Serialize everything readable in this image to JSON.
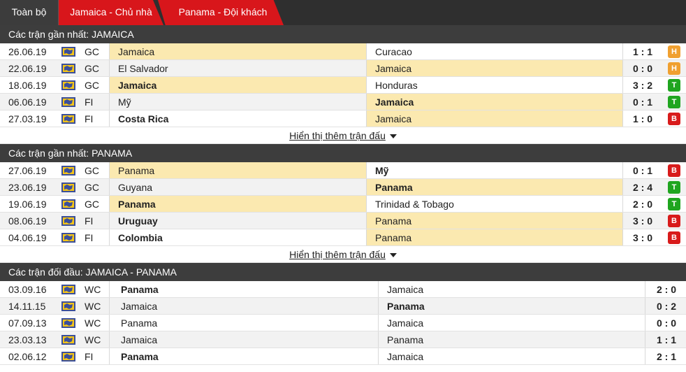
{
  "tabs": [
    "Toàn bộ",
    "Jamaica - Chủ nhà",
    "Panama - Đội khách"
  ],
  "show_more_label": "Hiển thị thêm trận đấu",
  "colors": {
    "hoa": "#f0a030",
    "thang": "#1fa51f",
    "bai": "#d81b1b",
    "highlight": "#fbe9b0"
  },
  "sections": [
    {
      "title": "Các trận gần nhất: JAMAICA",
      "rows": [
        {
          "date": "26.06.19",
          "comp": "GC",
          "home": "Jamaica",
          "away": "Curacao",
          "score": "1 : 1",
          "result": "H",
          "hl": "home",
          "bold": ""
        },
        {
          "date": "22.06.19",
          "comp": "GC",
          "home": "El Salvador",
          "away": "Jamaica",
          "score": "0 : 0",
          "result": "H",
          "hl": "away",
          "bold": ""
        },
        {
          "date": "18.06.19",
          "comp": "GC",
          "home": "Jamaica",
          "away": "Honduras",
          "score": "3 : 2",
          "result": "T",
          "hl": "home",
          "bold": "home"
        },
        {
          "date": "06.06.19",
          "comp": "FI",
          "home": "Mỹ",
          "away": "Jamaica",
          "score": "0 : 1",
          "result": "T",
          "hl": "away",
          "bold": "away"
        },
        {
          "date": "27.03.19",
          "comp": "FI",
          "home": "Costa Rica",
          "away": "Jamaica",
          "score": "1 : 0",
          "result": "B",
          "hl": "away",
          "bold": "home"
        }
      ]
    },
    {
      "title": "Các trận gần nhất: PANAMA",
      "rows": [
        {
          "date": "27.06.19",
          "comp": "GC",
          "home": "Panama",
          "away": "Mỹ",
          "score": "0 : 1",
          "result": "B",
          "hl": "home",
          "bold": "away"
        },
        {
          "date": "23.06.19",
          "comp": "GC",
          "home": "Guyana",
          "away": "Panama",
          "score": "2 : 4",
          "result": "T",
          "hl": "away",
          "bold": "away"
        },
        {
          "date": "19.06.19",
          "comp": "GC",
          "home": "Panama",
          "away": "Trinidad & Tobago",
          "score": "2 : 0",
          "result": "T",
          "hl": "home",
          "bold": "home"
        },
        {
          "date": "08.06.19",
          "comp": "FI",
          "home": "Uruguay",
          "away": "Panama",
          "score": "3 : 0",
          "result": "B",
          "hl": "away",
          "bold": "home"
        },
        {
          "date": "04.06.19",
          "comp": "FI",
          "home": "Colombia",
          "away": "Panama",
          "score": "3 : 0",
          "result": "B",
          "hl": "away",
          "bold": "home"
        }
      ]
    }
  ],
  "h2h": {
    "title": "Các trận đối đầu: JAMAICA - PANAMA",
    "rows": [
      {
        "date": "03.09.16",
        "comp": "WC",
        "home": "Panama",
        "away": "Jamaica",
        "score": "2 : 0",
        "bold": "home"
      },
      {
        "date": "14.11.15",
        "comp": "WC",
        "home": "Jamaica",
        "away": "Panama",
        "score": "0 : 2",
        "bold": "away"
      },
      {
        "date": "07.09.13",
        "comp": "WC",
        "home": "Panama",
        "away": "Jamaica",
        "score": "0 : 0",
        "bold": ""
      },
      {
        "date": "23.03.13",
        "comp": "WC",
        "home": "Jamaica",
        "away": "Panama",
        "score": "1 : 1",
        "bold": ""
      },
      {
        "date": "02.06.12",
        "comp": "FI",
        "home": "Panama",
        "away": "Jamaica",
        "score": "2 : 1",
        "bold": "home"
      }
    ]
  }
}
